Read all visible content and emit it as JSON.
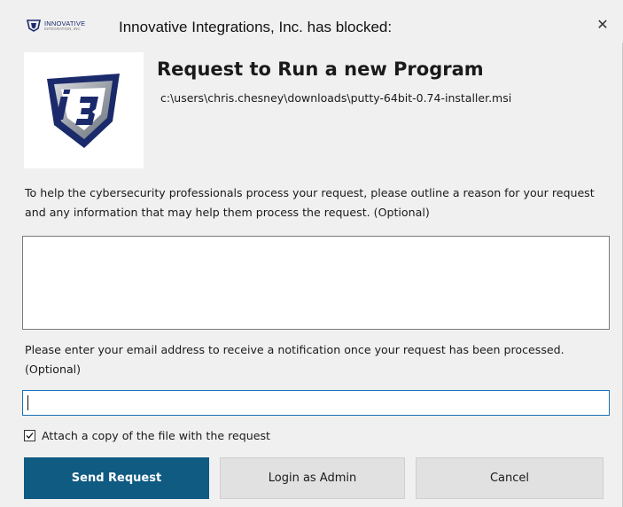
{
  "titlebar": {
    "logo_text": "INNOVATIVE",
    "logo_subtext": "INTEGRATION, INC",
    "title": "Innovative Integrations, Inc. has blocked:",
    "close_glyph": "✕"
  },
  "request": {
    "heading": "Request to Run a new Program",
    "file_path": "c:\\users\\chris.chesney\\downloads\\putty-64bit-0.74-installer.msi"
  },
  "reason": {
    "instructions": "To help the cybersecurity professionals process your request, please outline a reason for your request and any information that may help them process the request. (Optional)",
    "value": ""
  },
  "email": {
    "instructions": "Please enter your email address to receive a notification once your request has been processed. (Optional)",
    "value": ""
  },
  "attach": {
    "label": "Attach a copy of the file with the request",
    "checked": true
  },
  "buttons": {
    "send": "Send Request",
    "login": "Login as Admin",
    "cancel": "Cancel"
  },
  "colors": {
    "primary": "#0f5b82",
    "shield_navy": "#1b2a6b",
    "shield_silver": "#9aa0a8"
  },
  "icons": {
    "logo": "i3-shield-logo",
    "close": "close-icon",
    "checkbox": "checkmark-icon"
  }
}
